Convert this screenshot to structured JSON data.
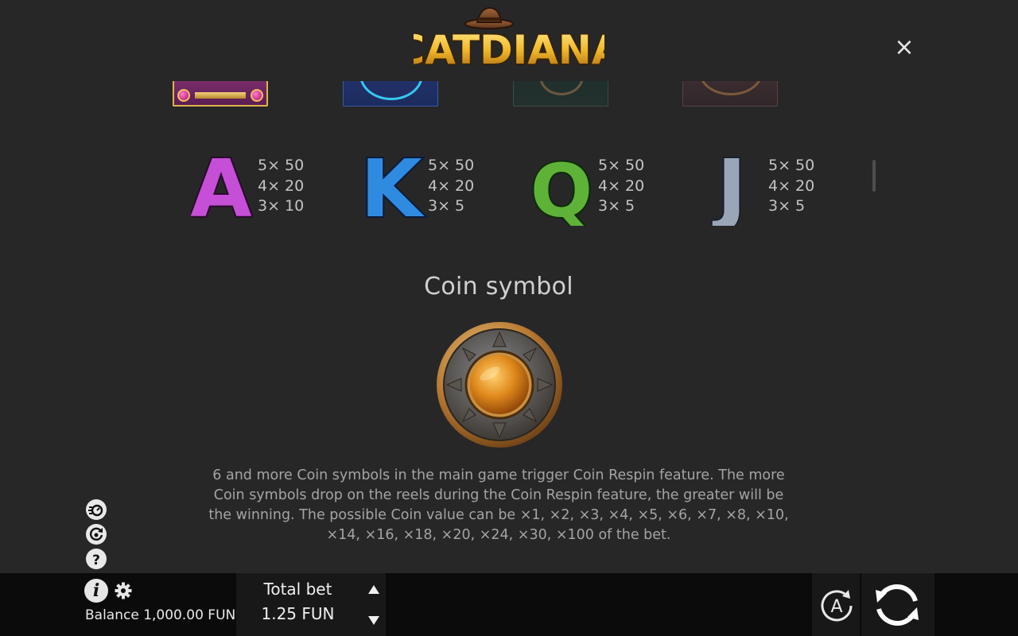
{
  "header": {
    "logo_text": "CATDIANA",
    "close_label": "×"
  },
  "paytable": [
    {
      "symbol": "A",
      "color": "#c54fd6",
      "pays": [
        "5× 50",
        "4× 20",
        "3× 10"
      ]
    },
    {
      "symbol": "K",
      "color": "#2f8be0",
      "pays": [
        "5× 50",
        "4× 20",
        "3× 5"
      ]
    },
    {
      "symbol": "Q",
      "color": "#5fb238",
      "pays": [
        "5× 50",
        "4× 20",
        "3× 5"
      ]
    },
    {
      "symbol": "J",
      "color": "#9aa6b8",
      "pays": [
        "5× 50",
        "4× 20",
        "3× 5"
      ]
    }
  ],
  "coin": {
    "title": "Coin symbol",
    "description": "6 and more Coin symbols in the main game trigger Coin Respin feature. The more Coin symbols drop on the reels during the Coin Respin feature, the greater will be the winning. The possible Coin value can be ×1, ×2, ×3, ×4, ×5, ×6, ×7, ×8, ×10, ×14, ×16, ×18, ×20, ×24, ×30, ×100 of the bet."
  },
  "side_buttons": [
    "turbo-icon",
    "history-icon",
    "help-icon"
  ],
  "bottom": {
    "info_label": "i",
    "balance": "Balance 1,000.00 FUN",
    "total_bet_label": "Total bet",
    "total_bet_value": "1.25 FUN",
    "auto_label": "A"
  },
  "colors": {
    "background": "#272727",
    "bottom_bar": "#0b0b0b",
    "logo_gold": "#e8b42c"
  }
}
